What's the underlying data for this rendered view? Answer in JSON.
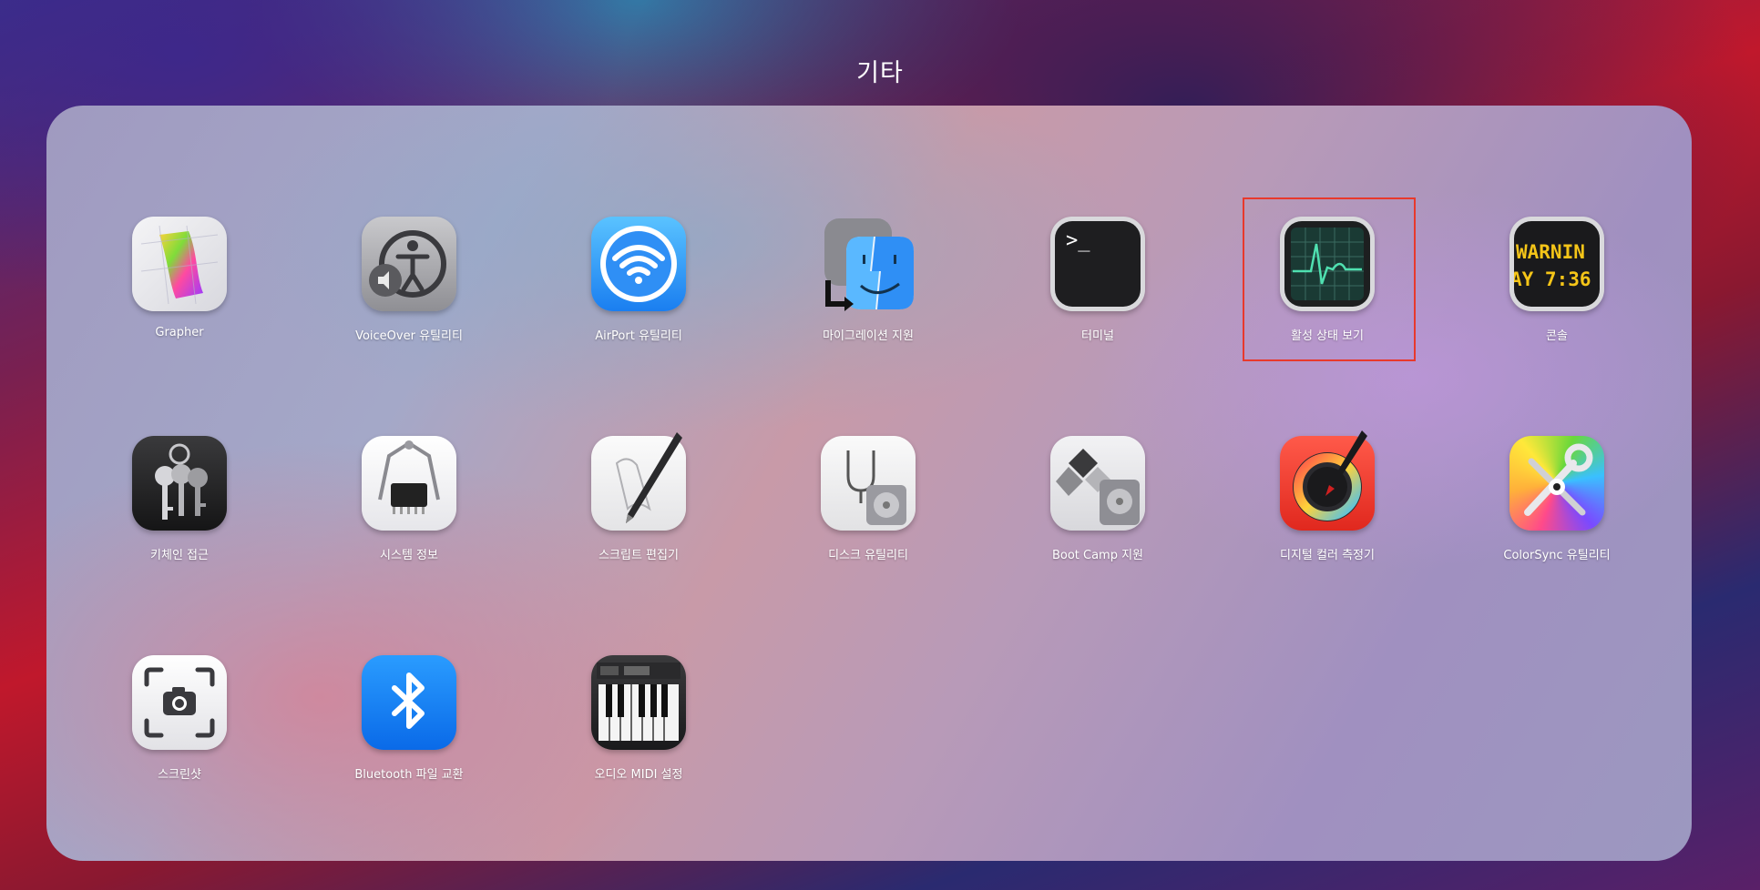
{
  "folder": {
    "title": "기타"
  },
  "apps": [
    {
      "label": "Grapher",
      "icon": "grapher-icon"
    },
    {
      "label": "VoiceOver 유틸리티",
      "icon": "voiceover-icon"
    },
    {
      "label": "AirPort 유틸리티",
      "icon": "airport-icon"
    },
    {
      "label": "마이그레이션 지원",
      "icon": "migration-assistant-icon"
    },
    {
      "label": "터미널",
      "icon": "terminal-icon",
      "icon_text": ">_"
    },
    {
      "label": "활성 상태 보기",
      "icon": "activity-monitor-icon",
      "highlighted": true
    },
    {
      "label": "콘솔",
      "icon": "console-icon",
      "icon_text_1": "WARNIN",
      "icon_text_2": "AY 7:36"
    },
    {
      "label": "키체인 접근",
      "icon": "keychain-icon"
    },
    {
      "label": "시스템 정보",
      "icon": "system-information-icon"
    },
    {
      "label": "스크립트 편집기",
      "icon": "script-editor-icon"
    },
    {
      "label": "디스크 유틸리티",
      "icon": "disk-utility-icon"
    },
    {
      "label": "Boot Camp 지원",
      "icon": "boot-camp-icon"
    },
    {
      "label": "디지털 컬러 측정기",
      "icon": "digital-color-meter-icon"
    },
    {
      "label": "ColorSync 유틸리티",
      "icon": "colorsync-icon"
    },
    {
      "label": "스크린샷",
      "icon": "screenshot-icon"
    },
    {
      "label": "Bluetooth 파일 교환",
      "icon": "bluetooth-icon"
    },
    {
      "label": "오디오 MIDI 설정",
      "icon": "audio-midi-icon"
    }
  ],
  "colors": {
    "highlight": "#e8392c"
  }
}
